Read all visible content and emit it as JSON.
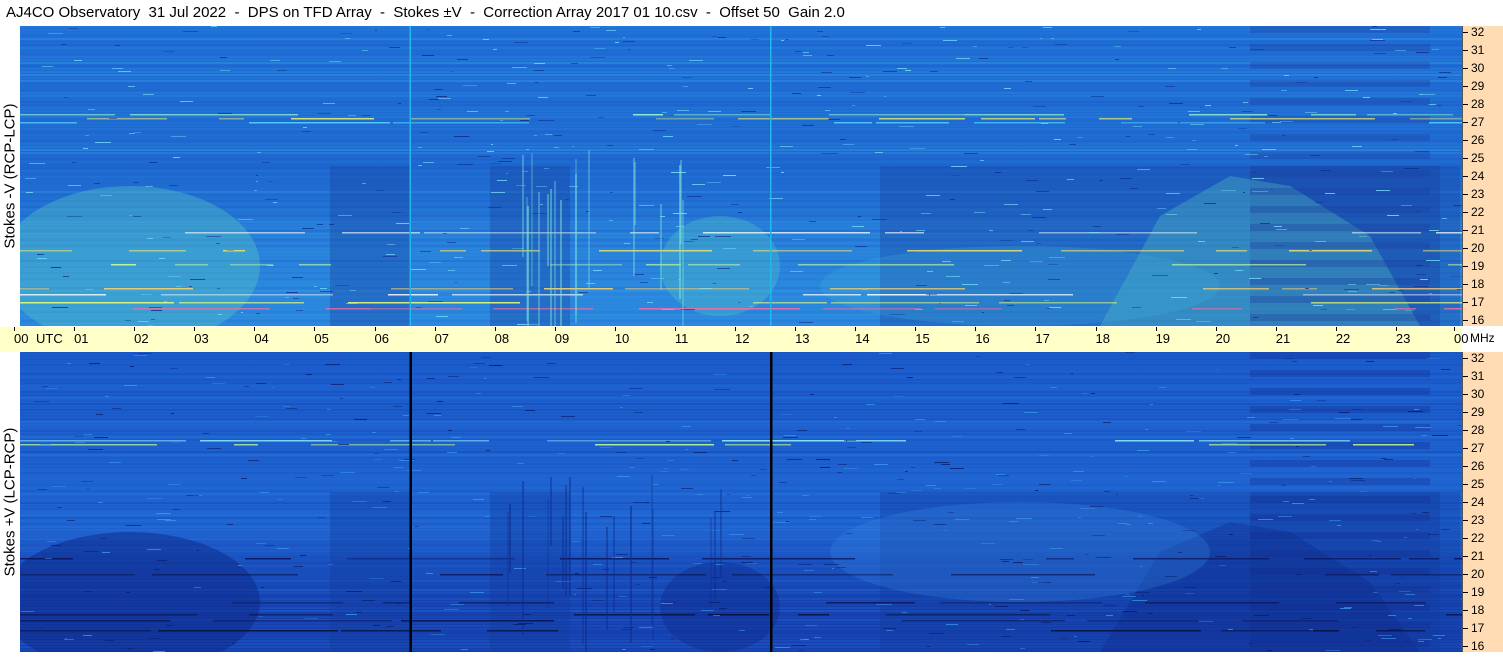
{
  "title": "AJ4CO Observatory  31 Jul 2022  -  DPS on TFD Array  -  Stokes ±V  -  Correction Array 2017 01 10.csv  -  Offset 50  Gain 2.0",
  "upper_panel": {
    "label": "Stokes -V (RCP-LCP)",
    "base_color": "#1d6fd2",
    "marker_color": "#22b8e8"
  },
  "lower_panel": {
    "label": "Stokes +V (LCP-RCP)",
    "base_color": "#1a59c8",
    "marker_color": "#000000"
  },
  "time_axis": {
    "labels": [
      "00",
      "01",
      "02",
      "03",
      "04",
      "05",
      "06",
      "07",
      "08",
      "09",
      "10",
      "11",
      "12",
      "13",
      "14",
      "15",
      "16",
      "17",
      "18",
      "19",
      "20",
      "21",
      "22",
      "23",
      "00"
    ],
    "utc_label": "UTC",
    "unit_label": "MHz",
    "background": "#ffffc8"
  },
  "freq_axis": {
    "ticks": [
      "32",
      "31",
      "30",
      "29",
      "28",
      "27",
      "26",
      "25",
      "24",
      "23",
      "22",
      "21",
      "20",
      "19",
      "18",
      "17",
      "16"
    ],
    "background": "#ffdcb4"
  },
  "marker_hours": [
    6.5,
    12.5
  ]
}
